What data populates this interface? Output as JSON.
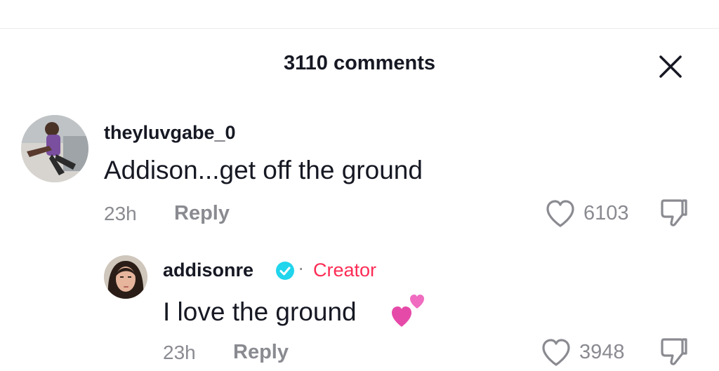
{
  "header": {
    "title": "3110 comments",
    "close_icon": "close-icon"
  },
  "comments": [
    {
      "username": "theyluvgabe_0",
      "text": "Addison...get off the ground",
      "time": "23h",
      "reply_label": "Reply",
      "likes": "6103"
    }
  ],
  "reply": {
    "username": "addisonre",
    "verified_icon": "verified-badge-icon",
    "separator": "·",
    "creator_label": "Creator",
    "text": "I love the ground",
    "emoji_icon": "two-hearts-icon",
    "time": "23h",
    "reply_label": "Reply",
    "likes": "3948"
  },
  "colors": {
    "accent": "#fe2c55",
    "verified": "#20d5ec",
    "muted": "#8a8b91",
    "text": "#161823"
  }
}
